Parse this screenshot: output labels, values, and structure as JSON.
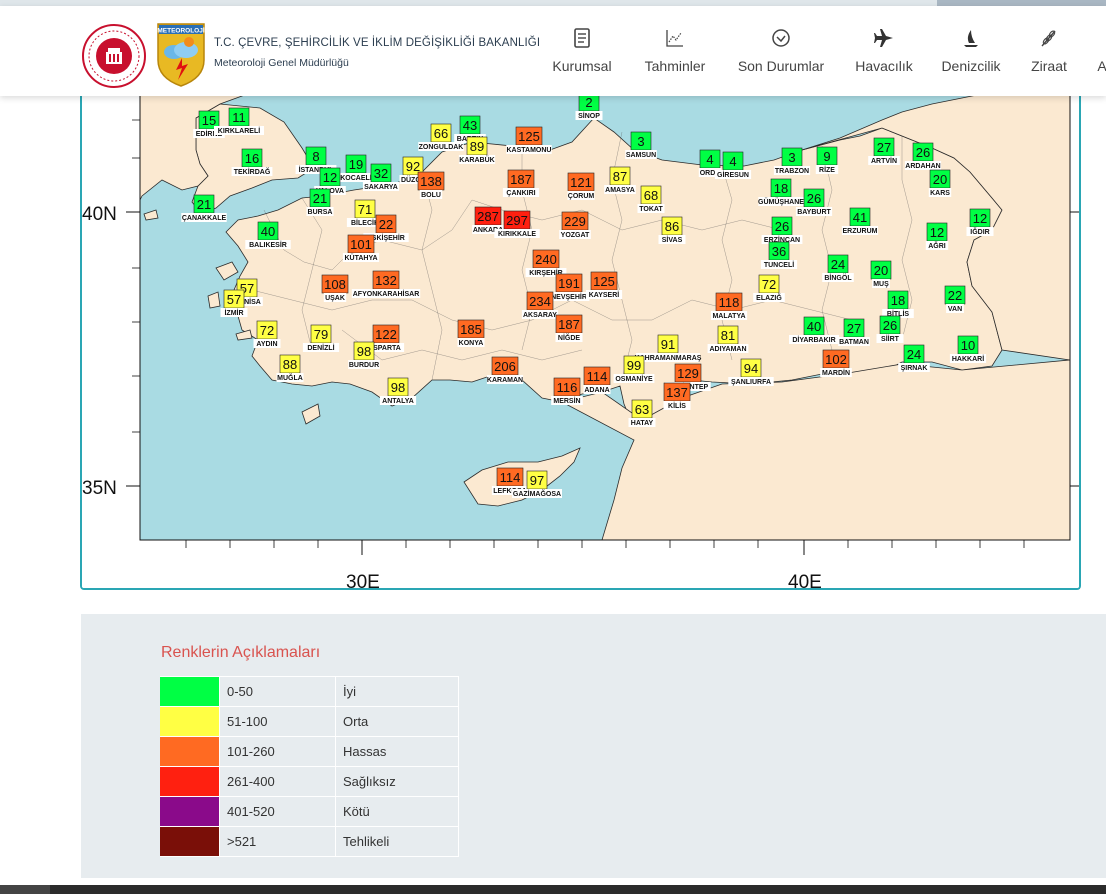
{
  "header": {
    "org_title": "T.C. ÇEVRE, ŞEHİRCİLİK VE İKLİM DEĞİŞİKLİĞİ BAKANLIĞI",
    "org_subtitle": "Meteoroloji Genel Müdürlüğü",
    "logo_text": "METEOROLOJİ",
    "nav": [
      {
        "label": "Kurumsal",
        "icon": "document-icon"
      },
      {
        "label": "Tahminler",
        "icon": "chart-icon"
      },
      {
        "label": "Son Durumlar",
        "icon": "check-circle-icon"
      },
      {
        "label": "Havacılık",
        "icon": "plane-icon"
      },
      {
        "label": "Denizcilik",
        "icon": "sailboat-icon"
      },
      {
        "label": "Ziraat",
        "icon": "wheat-icon"
      },
      {
        "label": "A",
        "icon": ""
      }
    ]
  },
  "map": {
    "lat_labels": [
      "40N",
      "35N"
    ],
    "lon_labels": [
      "30E",
      "40E"
    ],
    "colors": {
      "sea": "#a9dbe3",
      "land": "#fbe9d1",
      "border": "#2b2b2b"
    },
    "stations": [
      {
        "name": "SİNOP",
        "value": 2,
        "level": "iyi"
      },
      {
        "name": "EDİRNE",
        "value": 15,
        "level": "iyi"
      },
      {
        "name": "KIRKLARELİ",
        "value": 11,
        "level": "iyi"
      },
      {
        "name": "ZONGULDAK",
        "value": 66,
        "level": "orta"
      },
      {
        "name": "BARTIN",
        "value": 43,
        "level": "iyi"
      },
      {
        "name": "KARABÜK",
        "value": 89,
        "level": "orta"
      },
      {
        "name": "KASTAMONU",
        "value": 125,
        "level": "hassas"
      },
      {
        "name": "SAMSUN",
        "value": 3,
        "level": "iyi"
      },
      {
        "name": "TEKİRDAĞ",
        "value": 16,
        "level": "iyi"
      },
      {
        "name": "İSTANBUL",
        "value": 8,
        "level": "iyi"
      },
      {
        "name": "KOCAELİ",
        "value": 19,
        "level": "iyi"
      },
      {
        "name": "YALOVA",
        "value": 12,
        "level": "iyi"
      },
      {
        "name": "SAKARYA",
        "value": 32,
        "level": "iyi"
      },
      {
        "name": "DÜZCE",
        "value": 92,
        "level": "orta"
      },
      {
        "name": "BOLU",
        "value": 138,
        "level": "hassas"
      },
      {
        "name": "ÇANKIRI",
        "value": 187,
        "level": "hassas"
      },
      {
        "name": "ÇORUM",
        "value": 121,
        "level": "hassas"
      },
      {
        "name": "AMASYA",
        "value": 87,
        "level": "orta"
      },
      {
        "name": "TOKAT",
        "value": 68,
        "level": "orta"
      },
      {
        "name": "ORDU",
        "value": 4,
        "level": "iyi"
      },
      {
        "name": "GİRESUN",
        "value": 4,
        "level": "iyi"
      },
      {
        "name": "TRABZON",
        "value": 3,
        "level": "iyi"
      },
      {
        "name": "RİZE",
        "value": 9,
        "level": "iyi"
      },
      {
        "name": "ARTVİN",
        "value": 27,
        "level": "iyi"
      },
      {
        "name": "ARDAHAN",
        "value": 26,
        "level": "iyi"
      },
      {
        "name": "KARS",
        "value": 20,
        "level": "iyi"
      },
      {
        "name": "ÇANAKKALE",
        "value": 21,
        "level": "iyi"
      },
      {
        "name": "BURSA",
        "value": 21,
        "level": "iyi"
      },
      {
        "name": "BİLECİK",
        "value": 71,
        "level": "orta"
      },
      {
        "name": "ESKİŞEHİR",
        "value": 22,
        "level": "hassas"
      },
      {
        "name": "ANKARA",
        "value": 287,
        "level": "sagliksiz"
      },
      {
        "name": "KIRIKKALE",
        "value": 297,
        "level": "sagliksiz"
      },
      {
        "name": "YOZGAT",
        "value": 229,
        "level": "hassas"
      },
      {
        "name": "SİVAS",
        "value": 86,
        "level": "orta"
      },
      {
        "name": "GÜMÜŞHANE",
        "value": 18,
        "level": "iyi"
      },
      {
        "name": "BAYBURT",
        "value": 26,
        "level": "iyi"
      },
      {
        "name": "ERZURUM",
        "value": 41,
        "level": "iyi"
      },
      {
        "name": "IĞDIR",
        "value": 12,
        "level": "iyi"
      },
      {
        "name": "AĞRI",
        "value": 12,
        "level": "iyi"
      },
      {
        "name": "BALIKESİR",
        "value": 40,
        "level": "iyi"
      },
      {
        "name": "KÜTAHYA",
        "value": 101,
        "level": "hassas"
      },
      {
        "name": "ERZİNCAN",
        "value": 26,
        "level": "iyi"
      },
      {
        "name": "TUNCELİ",
        "value": 36,
        "level": "iyi"
      },
      {
        "name": "KIRŞEHİR",
        "value": 240,
        "level": "hassas"
      },
      {
        "name": "NEVŞEHİR",
        "value": 191,
        "level": "hassas"
      },
      {
        "name": "KAYSERİ",
        "value": 125,
        "level": "hassas"
      },
      {
        "name": "MANİSA",
        "value": 57,
        "level": "orta"
      },
      {
        "name": "İZMİR",
        "value": 57,
        "level": "orta"
      },
      {
        "name": "UŞAK",
        "value": 108,
        "level": "hassas"
      },
      {
        "name": "AFYONKARAHİSAR",
        "value": 132,
        "level": "hassas"
      },
      {
        "name": "AKSARAY",
        "value": 234,
        "level": "hassas"
      },
      {
        "name": "ELAZIĞ",
        "value": 72,
        "level": "orta"
      },
      {
        "name": "BİNGÖL",
        "value": 24,
        "level": "iyi"
      },
      {
        "name": "MUŞ",
        "value": 20,
        "level": "iyi"
      },
      {
        "name": "BİTLİS",
        "value": 18,
        "level": "iyi"
      },
      {
        "name": "VAN",
        "value": 22,
        "level": "iyi"
      },
      {
        "name": "MALATYA",
        "value": 118,
        "level": "hassas"
      },
      {
        "name": "AYDIN",
        "value": 72,
        "level": "orta"
      },
      {
        "name": "DENİZLİ",
        "value": 79,
        "level": "orta"
      },
      {
        "name": "ISPARTA",
        "value": 122,
        "level": "hassas"
      },
      {
        "name": "KONYA",
        "value": 185,
        "level": "hassas"
      },
      {
        "name": "NİĞDE",
        "value": 187,
        "level": "hassas"
      },
      {
        "name": "KAHRAMANMARAŞ",
        "value": 91,
        "level": "orta"
      },
      {
        "name": "ADIYAMAN",
        "value": 81,
        "level": "orta"
      },
      {
        "name": "DİYARBAKIR",
        "value": 40,
        "level": "iyi"
      },
      {
        "name": "BATMAN",
        "value": 27,
        "level": "iyi"
      },
      {
        "name": "SİİRT",
        "value": 26,
        "level": "iyi"
      },
      {
        "name": "BURDUR",
        "value": 98,
        "level": "orta"
      },
      {
        "name": "MUĞLA",
        "value": 88,
        "level": "orta"
      },
      {
        "name": "KARAMAN",
        "value": 206,
        "level": "hassas"
      },
      {
        "name": "OSMANİYE",
        "value": 99,
        "level": "orta"
      },
      {
        "name": "ADANA",
        "value": 114,
        "level": "hassas"
      },
      {
        "name": "GAZİANTEP",
        "value": 129,
        "level": "hassas"
      },
      {
        "name": "KİLİS",
        "value": 137,
        "level": "hassas"
      },
      {
        "name": "ŞANLIURFA",
        "value": 94,
        "level": "orta"
      },
      {
        "name": "MARDİN",
        "value": 102,
        "level": "hassas"
      },
      {
        "name": "ŞIRNAK",
        "value": 24,
        "level": "iyi"
      },
      {
        "name": "HAKKARİ",
        "value": 10,
        "level": "iyi"
      },
      {
        "name": "ANTALYA",
        "value": 98,
        "level": "orta"
      },
      {
        "name": "MERSİN",
        "value": 116,
        "level": "hassas"
      },
      {
        "name": "HATAY",
        "value": 63,
        "level": "orta"
      },
      {
        "name": "LEFKOŞA",
        "value": 114,
        "level": "hassas"
      },
      {
        "name": "GAZİMAĞOSA",
        "value": 97,
        "level": "orta"
      }
    ]
  },
  "legend": {
    "title": "Renklerin Açıklamaları",
    "items": [
      {
        "color": "#00ff44",
        "range": "0-50",
        "label": "İyi",
        "level": "iyi"
      },
      {
        "color": "#ffff44",
        "range": "51-100",
        "label": "Orta",
        "level": "orta"
      },
      {
        "color": "#ff6a22",
        "range": "101-260",
        "label": "Hassas",
        "level": "hassas"
      },
      {
        "color": "#ff2010",
        "range": "261-400",
        "label": "Sağlıksız",
        "level": "sagliksiz"
      },
      {
        "color": "#8a0a8a",
        "range": "401-520",
        "label": "Kötü",
        "level": "kotu"
      },
      {
        "color": "#7a0f08",
        "range": ">521",
        "label": "Tehlikeli",
        "level": "tehlikeli"
      }
    ]
  }
}
